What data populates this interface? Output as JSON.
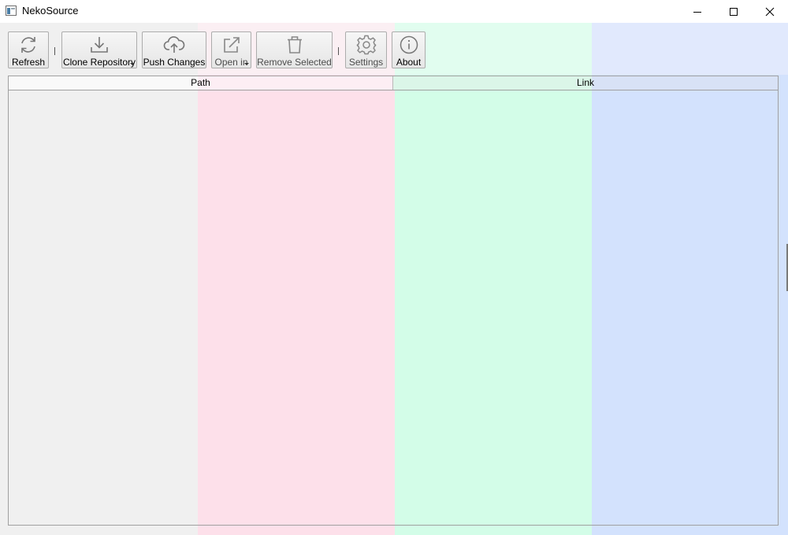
{
  "window": {
    "title": "NekoSource"
  },
  "toolbar": {
    "buttons": [
      {
        "label": "Refresh",
        "icon": "refresh-icon"
      },
      {
        "label": "Clone Repository",
        "icon": "download-icon"
      },
      {
        "label": "Push Changes",
        "icon": "cloud-upload-icon"
      },
      {
        "label": "Open in",
        "icon": "external-link-icon"
      },
      {
        "label": "Remove Selected",
        "icon": "trash-icon"
      },
      {
        "label": "Settings",
        "icon": "gear-icon"
      },
      {
        "label": "About",
        "icon": "info-icon"
      }
    ]
  },
  "table": {
    "columns": [
      "Path",
      "Link"
    ],
    "rows": []
  },
  "colors": {
    "band_pink": "#fde0ea",
    "band_green": "#d3fde8",
    "band_blue": "#d3e2fd",
    "window_bg": "#f0f0f0"
  }
}
